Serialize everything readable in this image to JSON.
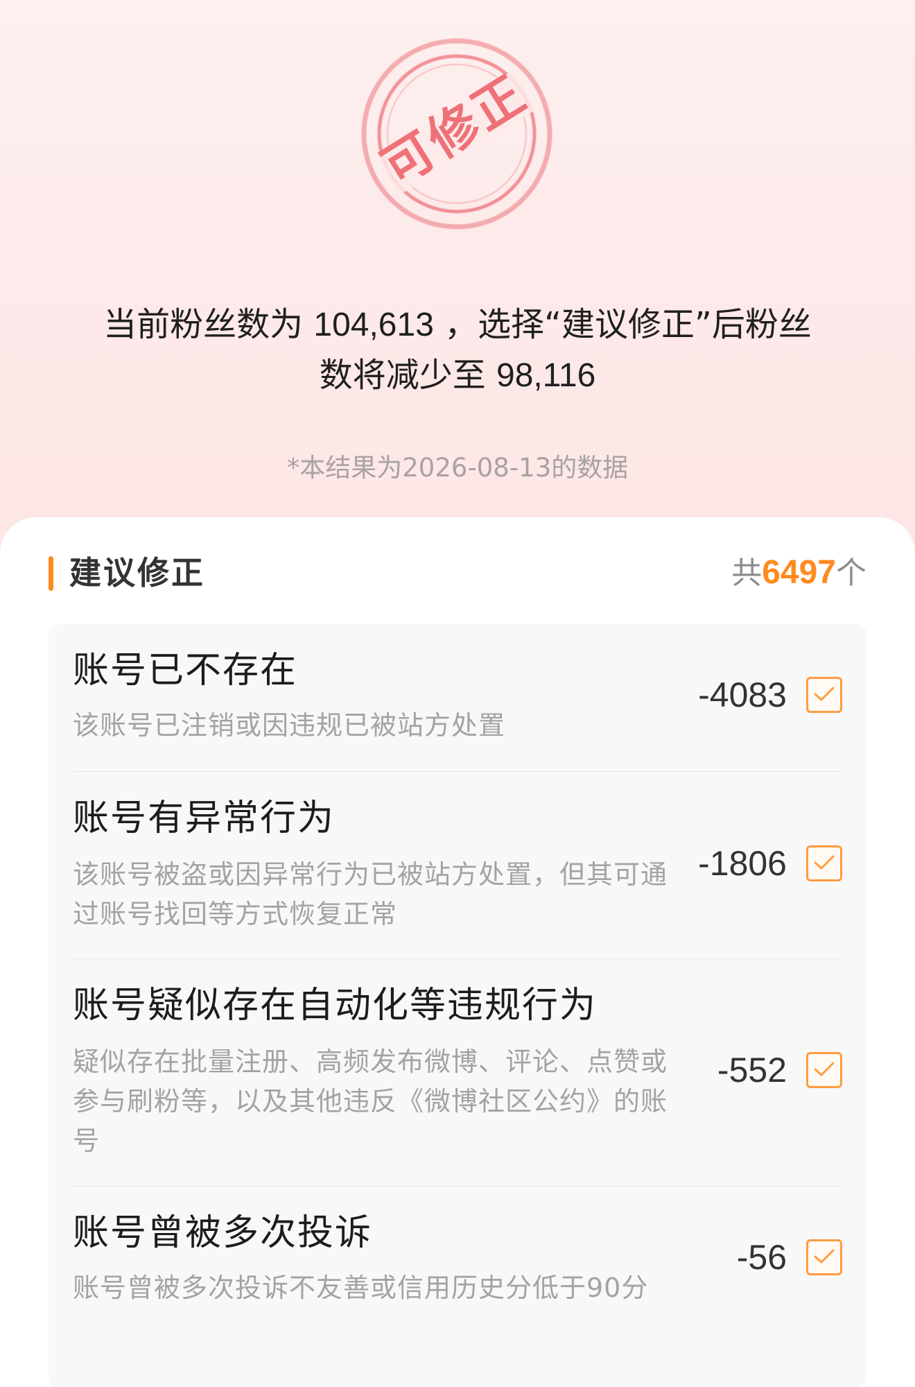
{
  "header": {
    "stamp_text": "可修正",
    "summary_part1": "当前粉丝数为",
    "current_fans": "104,613",
    "summary_part2": "，选择“建议修正”后粉丝",
    "summary_part3": "数将减少至",
    "resulting_fans": "98,116",
    "date_note": "*本结果为2026-08-13的数据"
  },
  "section": {
    "title": "建议修正",
    "total_prefix": "共",
    "total_count": "6497",
    "total_suffix": "个"
  },
  "items": [
    {
      "title": "账号已不存在",
      "desc": "该账号已注销或因违规已被站方处置",
      "value": "-4083",
      "checked": true
    },
    {
      "title": "账号有异常行为",
      "desc": "该账号被盗或因异常行为已被站方处置，但其可通过账号找回等方式恢复正常",
      "value": "-1806",
      "checked": true
    },
    {
      "title": "账号疑似存在自动化等违规行为",
      "desc": "疑似存在批量注册、高频发布微博、评论、点赞或参与刷粉等，以及其他违反《微博社区公约》的账号",
      "value": "-552",
      "checked": true
    },
    {
      "title": "账号曾被多次投诉",
      "desc": "账号曾被多次投诉不友善或信用历史分低于90分",
      "value": "-56",
      "checked": true
    }
  ],
  "colors": {
    "accent": "#ff8a1e",
    "stamp": "#f07e84",
    "hero_bg": "#fdeaea"
  }
}
